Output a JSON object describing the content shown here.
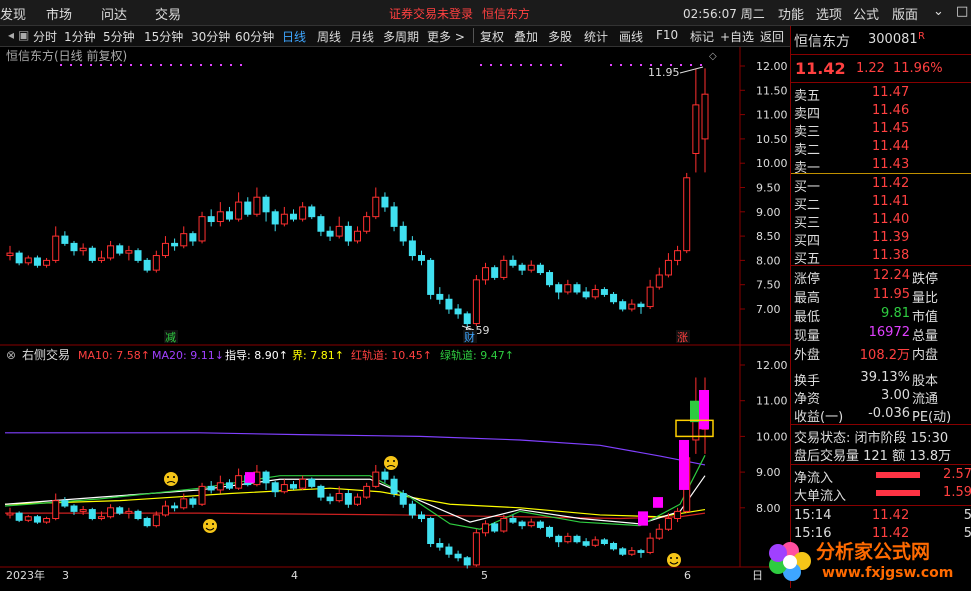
{
  "topbar": {
    "menu": [
      "发现",
      "市场",
      "问达",
      "交易"
    ],
    "login_status": "证券交易未登录",
    "stock_name": "恒信东方",
    "clock": "02:56:07 周二",
    "right_menu": [
      "功能",
      "选项",
      "公式",
      "版面"
    ],
    "min_icon": "⌄",
    "max_icon": "□"
  },
  "toolbar": {
    "periods": [
      "分时",
      "1分钟",
      "5分钟",
      "15分钟",
      "30分钟",
      "60分钟",
      "日线",
      "周线",
      "月线",
      "多周期",
      "更多 >"
    ],
    "active": "日线",
    "tools": [
      "复权",
      "叠加",
      "多股",
      "统计",
      "画线",
      "F10",
      "标记",
      "+自选",
      "返回"
    ]
  },
  "main_chart": {
    "title": "恒信东方(日线 前复权)",
    "price_ticks": [
      "12.00",
      "11.50",
      "11.00",
      "10.50",
      "10.00",
      "9.50",
      "9.00",
      "8.50",
      "8.00",
      "7.50",
      "7.00"
    ],
    "high_label": "11.95",
    "low_label": "6.59",
    "markers": [
      {
        "text": "减",
        "color": "#2ecc40"
      },
      {
        "text": "财",
        "color": "#3ea6ff"
      },
      {
        "text": "涨",
        "color": "#ff4040"
      }
    ]
  },
  "indicator": {
    "name": "右侧交易",
    "ma10": "MA10: 7.58↑",
    "ma20": "MA20: 9.11↓",
    "guide": "指导: 8.90↑",
    "bound": "界: 7.81↑",
    "red_rail": "红轨道: 10.45↑",
    "green_rail": "绿轨道: 9.47↑",
    "ticks": [
      "12.00",
      "11.00",
      "10.00",
      "9.00",
      "8.00"
    ],
    "colors": {
      "ma10": "#ff4040",
      "ma20": "#a040ff",
      "guide": "#ffffff",
      "bound": "#ffff00",
      "red_rail": "#ff4040",
      "green_rail": "#2ecc40"
    }
  },
  "x_axis": {
    "labels": [
      "2023年",
      "3",
      "4",
      "5",
      "6",
      "日"
    ]
  },
  "quote": {
    "name": "恒信东方",
    "code": "300081",
    "flag": "R",
    "price": "11.42",
    "change": "1.22",
    "pct": "11.96%",
    "asks": [
      {
        "label": "卖五",
        "price": "11.47"
      },
      {
        "label": "卖四",
        "price": "11.46"
      },
      {
        "label": "卖三",
        "price": "11.45"
      },
      {
        "label": "卖二",
        "price": "11.44"
      },
      {
        "label": "卖一",
        "price": "11.43"
      }
    ],
    "bids": [
      {
        "label": "买一",
        "price": "11.42"
      },
      {
        "label": "买二",
        "price": "11.41"
      },
      {
        "label": "买三",
        "price": "11.40"
      },
      {
        "label": "买四",
        "price": "11.39"
      },
      {
        "label": "买五",
        "price": "11.38"
      }
    ],
    "stats": [
      {
        "label": "涨停",
        "value": "12.24",
        "color": "#ff4040",
        "ext": "跌停"
      },
      {
        "label": "最高",
        "value": "11.95",
        "color": "#ff4040",
        "ext": "量比"
      },
      {
        "label": "最低",
        "value": "9.81",
        "color": "#2ecc40",
        "ext": "市值"
      },
      {
        "label": "现量",
        "value": "16972",
        "color": "#e040ff",
        "ext": "总量"
      },
      {
        "label": "外盘",
        "value": "108.2万",
        "color": "#ff4040",
        "ext": "内盘"
      },
      {
        "label": "换手",
        "value": "39.13%",
        "color": "#ddd",
        "ext": "股本"
      },
      {
        "label": "净资",
        "value": "3.00",
        "color": "#ddd",
        "ext": "流通"
      },
      {
        "label": "收益(一)",
        "value": "-0.036",
        "color": "#ddd",
        "ext": "PE(动)"
      }
    ],
    "trade_status": "交易状态: 闭市阶段 15:30",
    "after_hours": "盘后交易量 121 额 13.8万",
    "net_inflow_label": "净流入",
    "net_inflow_val": "2.57",
    "big_inflow_label": "大单流入",
    "big_inflow_val": "1.59",
    "ticks_list": [
      {
        "time": "15:14",
        "price": "11.42",
        "vol": "5"
      },
      {
        "time": "15:16",
        "price": "11.42",
        "vol": "5"
      }
    ]
  },
  "watermark": {
    "brand": "分析家公式网",
    "url": "www.fxjgsw.com"
  }
}
